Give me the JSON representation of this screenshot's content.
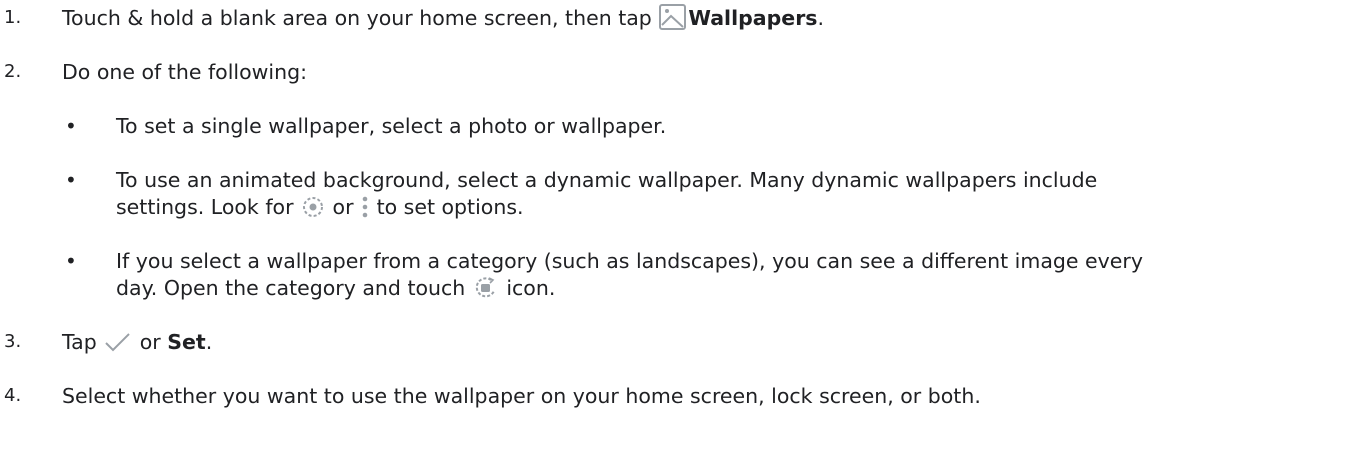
{
  "steps": [
    {
      "number": "1.",
      "text_before": "Touch & hold a blank area on your home screen, then tap ",
      "icon": "wallpaper-image-icon",
      "bold": "Wallpapers",
      "text_after": "."
    },
    {
      "number": "2.",
      "text": "Do one of the following:",
      "bullets": [
        {
          "dot": "•",
          "text": "To set a single wallpaper, select a photo or wallpaper."
        },
        {
          "dot": "•",
          "line1": "To use an animated background, select a dynamic wallpaper. Many dynamic wallpapers include",
          "line2_before": "settings. Look for ",
          "icon1": "gear-icon",
          "line2_middle": " or ",
          "icon2": "more-vertical-icon",
          "line2_after": " to set options."
        },
        {
          "dot": "•",
          "line1": "If you select a wallpaper from a category (such as landscapes), you can see a different image every",
          "line2_before": "day. Open the category and touch ",
          "icon": "rotate-image-icon",
          "line2_after": " icon."
        }
      ]
    },
    {
      "number": "3.",
      "text_before": "Tap ",
      "icon": "checkmark-icon",
      "text_middle": " or ",
      "bold": "Set",
      "text_after": "."
    },
    {
      "number": "4.",
      "text": "Select whether you want to use the wallpaper on your home screen, lock screen, or both."
    }
  ],
  "colors": {
    "text": "#202124",
    "icon": "#9aa0a6"
  }
}
